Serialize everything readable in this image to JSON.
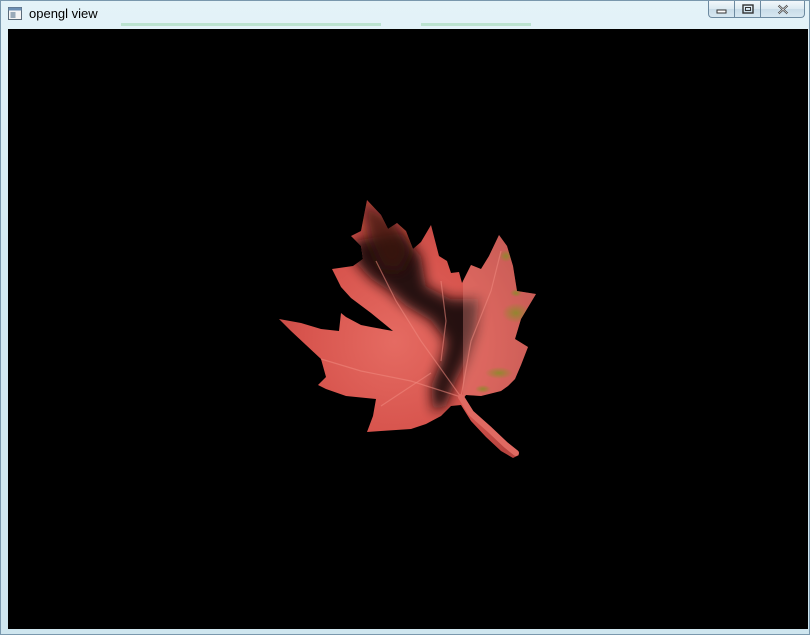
{
  "window": {
    "title": "opengl view",
    "background_color": "#000000"
  },
  "titlebar": {
    "icon": "app-window-icon",
    "controls": [
      {
        "name": "minimize-button",
        "icon": "minimize-icon"
      },
      {
        "name": "restore-button",
        "icon": "restore-icon"
      },
      {
        "name": "close-button",
        "icon": "close-icon"
      }
    ]
  },
  "scene": {
    "object": "maple-leaf-texture",
    "leaf_color": "#d9574f",
    "shadow_color": "#1a0707"
  }
}
